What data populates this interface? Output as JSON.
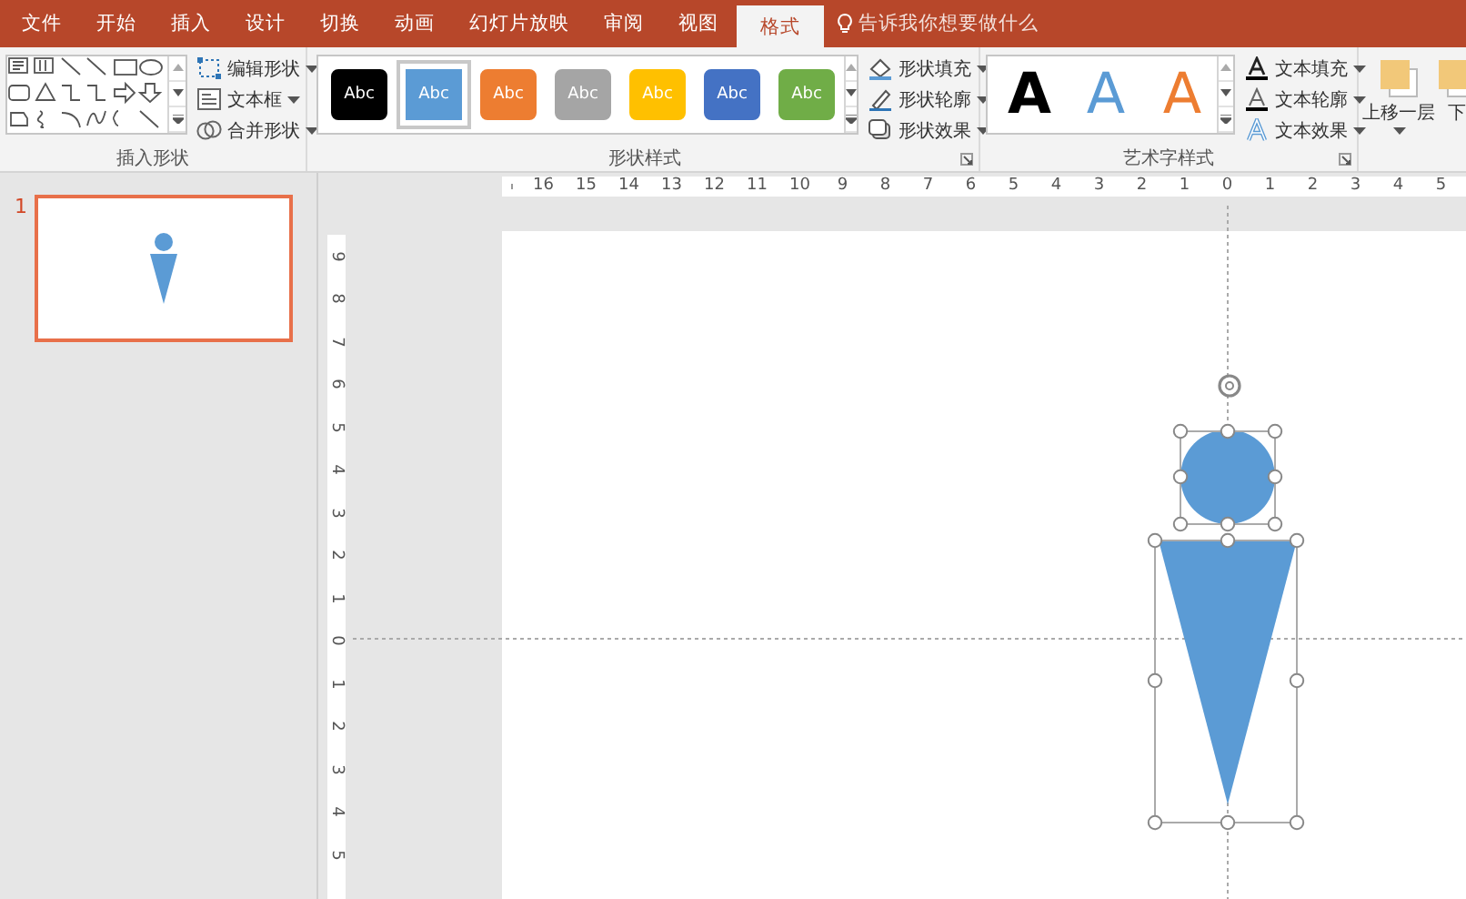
{
  "tabs": [
    {
      "label": "文件",
      "selected": false
    },
    {
      "label": "开始",
      "selected": false
    },
    {
      "label": "插入",
      "selected": false
    },
    {
      "label": "设计",
      "selected": false
    },
    {
      "label": "切换",
      "selected": false
    },
    {
      "label": "动画",
      "selected": false
    },
    {
      "label": "幻灯片放映",
      "selected": false
    },
    {
      "label": "审阅",
      "selected": false
    },
    {
      "label": "视图",
      "selected": false
    },
    {
      "label": "格式",
      "selected": true
    }
  ],
  "tell_me": {
    "placeholder": "告诉我你想要做什么"
  },
  "insert_shapes": {
    "label": "插入形状",
    "commands": [
      {
        "label": "编辑形状",
        "kind": "edit"
      },
      {
        "label": "文本框",
        "kind": "textbox"
      },
      {
        "label": "合并形状",
        "kind": "merge"
      }
    ]
  },
  "shape_styles": {
    "label": "形状样式",
    "styles": [
      {
        "label": "Abc",
        "color": "#000000",
        "selected": false
      },
      {
        "label": "Abc",
        "color": "#5b9bd5",
        "selected": true
      },
      {
        "label": "Abc",
        "color": "#ed7d31",
        "selected": false
      },
      {
        "label": "Abc",
        "color": "#a5a5a5",
        "selected": false
      },
      {
        "label": "Abc",
        "color": "#ffc000",
        "selected": false
      },
      {
        "label": "Abc",
        "color": "#4472c4",
        "selected": false
      },
      {
        "label": "Abc",
        "color": "#70ad47",
        "selected": false
      }
    ],
    "commands": [
      {
        "label": "形状填充",
        "kind": "fill"
      },
      {
        "label": "形状轮廓",
        "kind": "outline"
      },
      {
        "label": "形状效果",
        "kind": "effects"
      }
    ]
  },
  "wordart_styles": {
    "label": "艺术字样式",
    "styles": [
      {
        "label": "A",
        "kind": "solid",
        "color": "#000000"
      },
      {
        "label": "A",
        "kind": "outline",
        "color": "#5b9bd5"
      },
      {
        "label": "A",
        "kind": "outline",
        "color": "#ed7d31"
      }
    ],
    "commands": [
      {
        "label": "文本填充",
        "kind": "text-fill"
      },
      {
        "label": "文本轮廓",
        "kind": "text-outline"
      },
      {
        "label": "文本效果",
        "kind": "text-effects"
      }
    ]
  },
  "arrange": {
    "commands": [
      {
        "label": "上移一层"
      },
      {
        "label": "下"
      }
    ]
  },
  "slides": [
    {
      "number": "1",
      "selected": true
    }
  ],
  "rulers": {
    "horizontal": [
      "16",
      "15",
      "14",
      "13",
      "12",
      "11",
      "10",
      "9",
      "8",
      "7",
      "6",
      "5",
      "4",
      "3",
      "2",
      "1",
      "0",
      "1",
      "2",
      "3",
      "4",
      "5"
    ],
    "vertical": [
      "9",
      "8",
      "7",
      "6",
      "5",
      "4",
      "3",
      "2",
      "1",
      "0",
      "1",
      "2",
      "3",
      "4",
      "5"
    ]
  }
}
